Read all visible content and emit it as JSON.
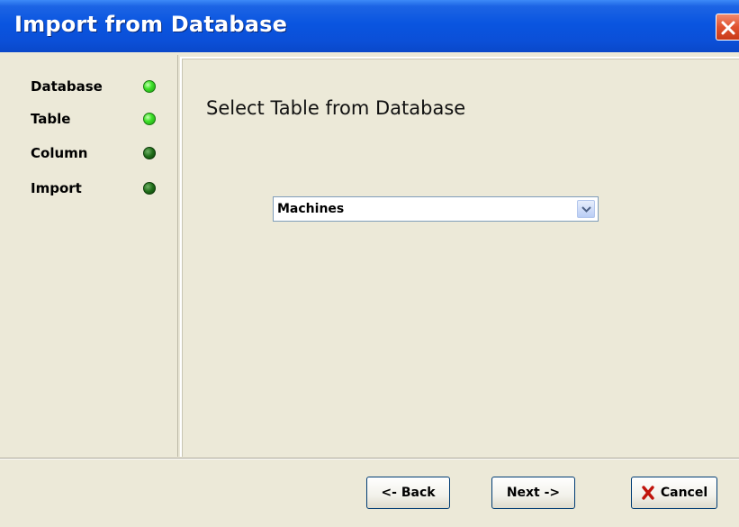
{
  "window": {
    "title": "Import from Database"
  },
  "steps": [
    {
      "label": "Database",
      "status": "active"
    },
    {
      "label": "Table",
      "status": "active"
    },
    {
      "label": "Column",
      "status": "inactive"
    },
    {
      "label": "Import",
      "status": "inactive"
    }
  ],
  "main": {
    "heading": "Select Table from Database",
    "table_select": {
      "value": "Machines"
    }
  },
  "buttons": {
    "back": "<- Back",
    "next": "Next ->",
    "cancel": "Cancel"
  },
  "colors": {
    "titlebar": "#0a55e0",
    "led_on": "#3fe22a",
    "led_off": "#1f6d18",
    "dialog_bg": "#ece9d8"
  }
}
